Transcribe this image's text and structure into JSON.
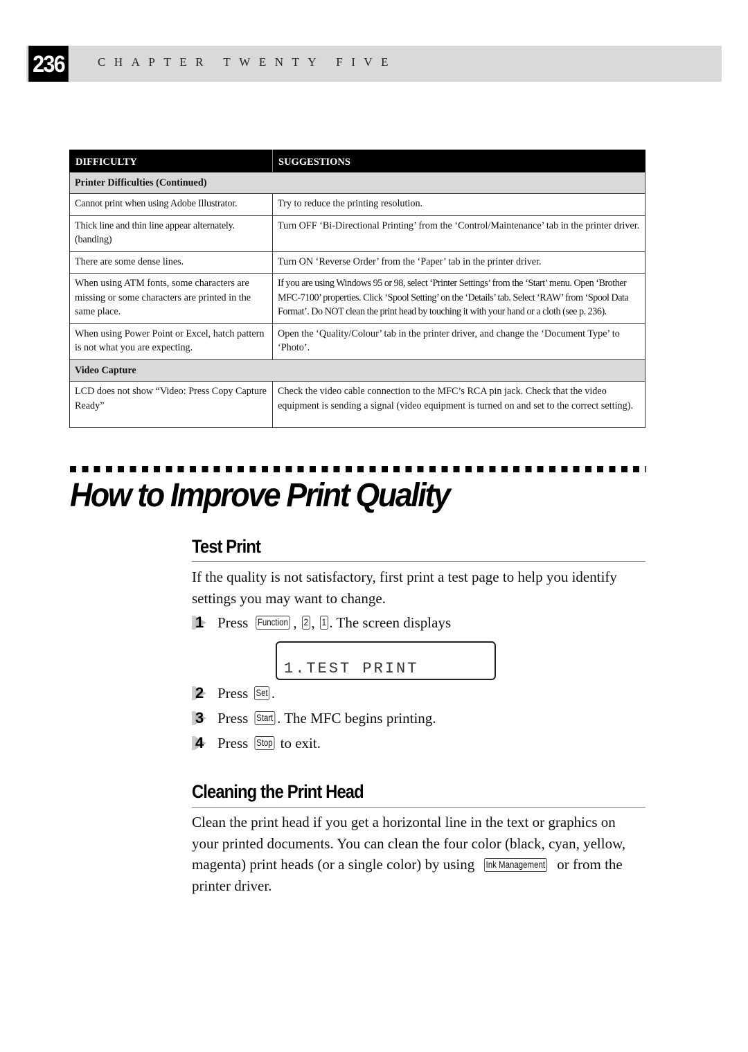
{
  "header": {
    "page_number": "236",
    "chapter": "CHAPTER TWENTY FIVE"
  },
  "table": {
    "headers": [
      "DIFFICULTY",
      "SUGGESTIONS"
    ],
    "sections": [
      {
        "title": "Printer Difficulties (Continued)",
        "rows": [
          {
            "difficulty": "Cannot print when using Adobe Illustrator.",
            "suggestion": "Try to reduce the printing resolution."
          },
          {
            "difficulty": "Thick line and thin line appear alternately. (banding)",
            "suggestion": "Turn OFF ‘Bi-Directional Printing’ from the ‘Control/Maintenance’ tab in the printer driver."
          },
          {
            "difficulty": "There are some dense lines.",
            "suggestion": "Turn ON ‘Reverse Order’ from the ‘Paper’ tab in the printer driver."
          },
          {
            "difficulty": "When using ATM fonts, some characters are missing or some characters are printed in the same place.",
            "suggestion": "If you are using Windows 95 or 98, select ‘Printer Settings’ from the ‘Start’ menu. Open ‘Brother MFC-7100’ properties. Click ‘Spool Setting’ on the ‘Details’ tab. Select ‘RAW’ from ‘Spool Data Format’. Do NOT clean the print head by touching it with your hand or a cloth (see p. 236)."
          },
          {
            "difficulty": "When using Power Point or Excel, hatch pattern is not what you are expecting.",
            "suggestion": "Open the ‘Quality/Colour’ tab in the printer driver, and change the ‘Document Type’ to ‘Photo’."
          }
        ]
      },
      {
        "title": "Video Capture",
        "rows": [
          {
            "difficulty": "LCD does not show “Video: Press Copy Capture Ready”",
            "suggestion": "Check the video cable connection to the MFC’s RCA pin jack. Check that the video equipment is sending a signal (video equipment is turned on and set to the correct setting)."
          }
        ]
      }
    ]
  },
  "section_title": "How to Improve Print Quality",
  "test_print": {
    "heading": "Test Print",
    "intro": "If the quality is not satisfactory, first print a test page to help you identify settings you may want to change.",
    "lcd_display": "1.TEST PRINT",
    "steps": [
      {
        "num": "1",
        "pre": "Press",
        "keys": [
          "Function",
          "2",
          "1"
        ],
        "post": ". The screen displays"
      },
      {
        "num": "2",
        "pre": "Press",
        "keys": [
          "Set"
        ],
        "post": "."
      },
      {
        "num": "3",
        "pre": "Press",
        "keys": [
          "Start"
        ],
        "post": ". The MFC begins printing."
      },
      {
        "num": "4",
        "pre": "Press",
        "keys": [
          "Stop"
        ],
        "post": " to exit."
      }
    ]
  },
  "cleaning": {
    "heading": "Cleaning the Print Head",
    "text_before": "Clean the print head if you get a horizontal line in the text or graphics on your printed documents. You can clean the four color (black, cyan, yellow, magenta) print heads (or a single color) by using",
    "key": "Ink Management",
    "text_after": " or from the printer driver."
  }
}
